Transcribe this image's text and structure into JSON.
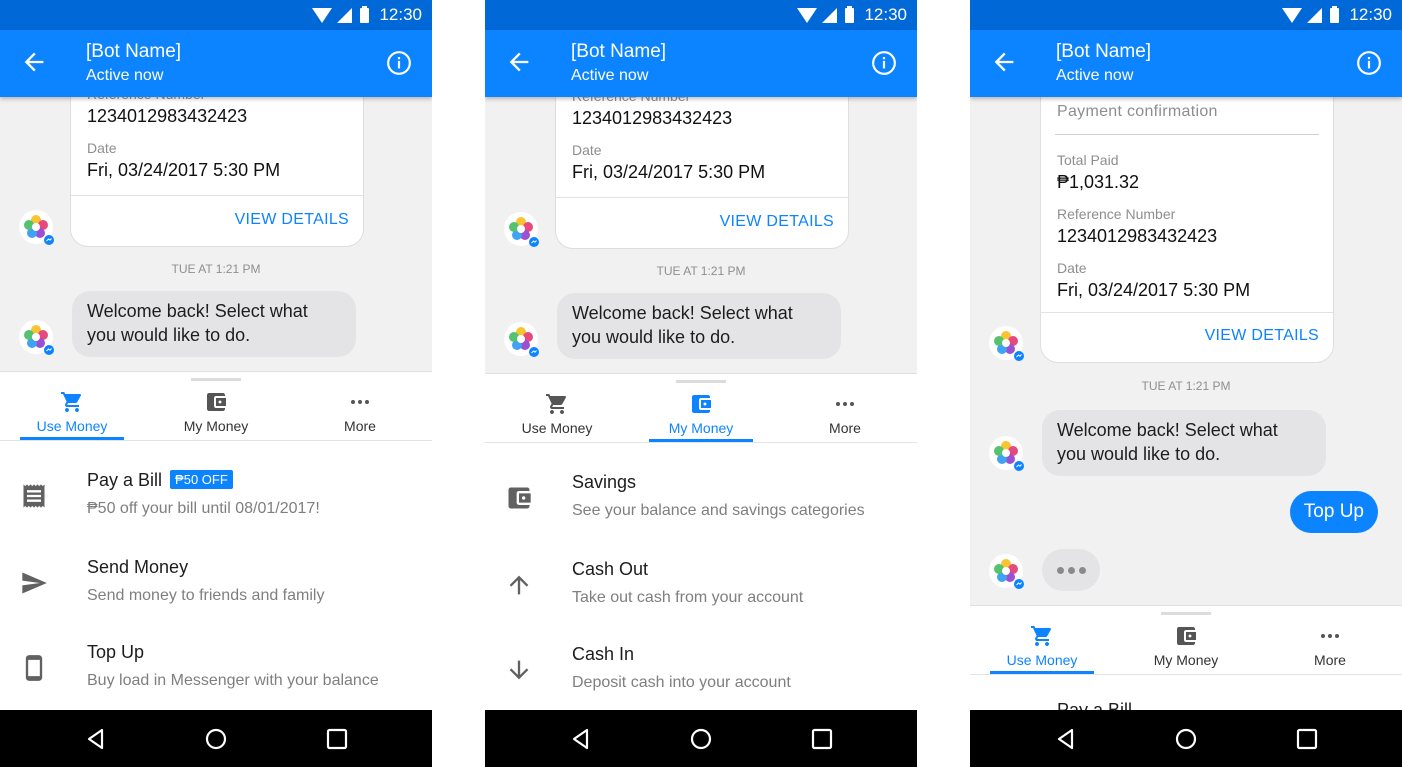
{
  "status_bar": {
    "time": "12:30"
  },
  "header": {
    "title": "[Bot Name]",
    "subtitle": "Active now"
  },
  "receipt": {
    "title": "Payment confirmation",
    "ref_label": "Reference Number",
    "ref_value": "1234012983432423",
    "date_label": "Date",
    "date_value": "Fri, 03/24/2017 5:30 PM",
    "total_label": "Total Paid",
    "total_value": "₱1,031.32",
    "action": "VIEW DETAILS"
  },
  "chat": {
    "timestamp": "TUE AT 1:21 PM",
    "bot_message": "Welcome back! Select what you would like to do.",
    "user_message": "Top Up"
  },
  "tabs": [
    {
      "label": "Use Money",
      "icon": "cart-icon"
    },
    {
      "label": "My Money",
      "icon": "wallet-icon"
    },
    {
      "label": "More",
      "icon": "more-icon"
    }
  ],
  "use_money_menu": [
    {
      "title": "Pay a Bill",
      "subtitle": "₱50 off your bill until 08/01/2017!",
      "badge": "₱50 OFF",
      "icon": "bill-icon"
    },
    {
      "title": "Send Money",
      "subtitle": "Send money to friends and family",
      "icon": "send-icon"
    },
    {
      "title": "Top Up",
      "subtitle": "Buy load in Messenger with your balance",
      "icon": "phone-icon"
    }
  ],
  "my_money_menu": [
    {
      "title": "Savings",
      "subtitle": "See your balance and savings categories",
      "icon": "wallet-icon"
    },
    {
      "title": "Cash Out",
      "subtitle": "Take out cash from your account",
      "icon": "arrow-up-icon"
    },
    {
      "title": "Cash In",
      "subtitle": "Deposit cash into your account",
      "icon": "arrow-down-icon"
    }
  ],
  "colors": {
    "status_bar": "#0168d8",
    "app_bar": "#0d84ff",
    "accent": "#0d84ff",
    "bot_bubble": "#e4e4e6",
    "nav_bar": "#000000"
  }
}
